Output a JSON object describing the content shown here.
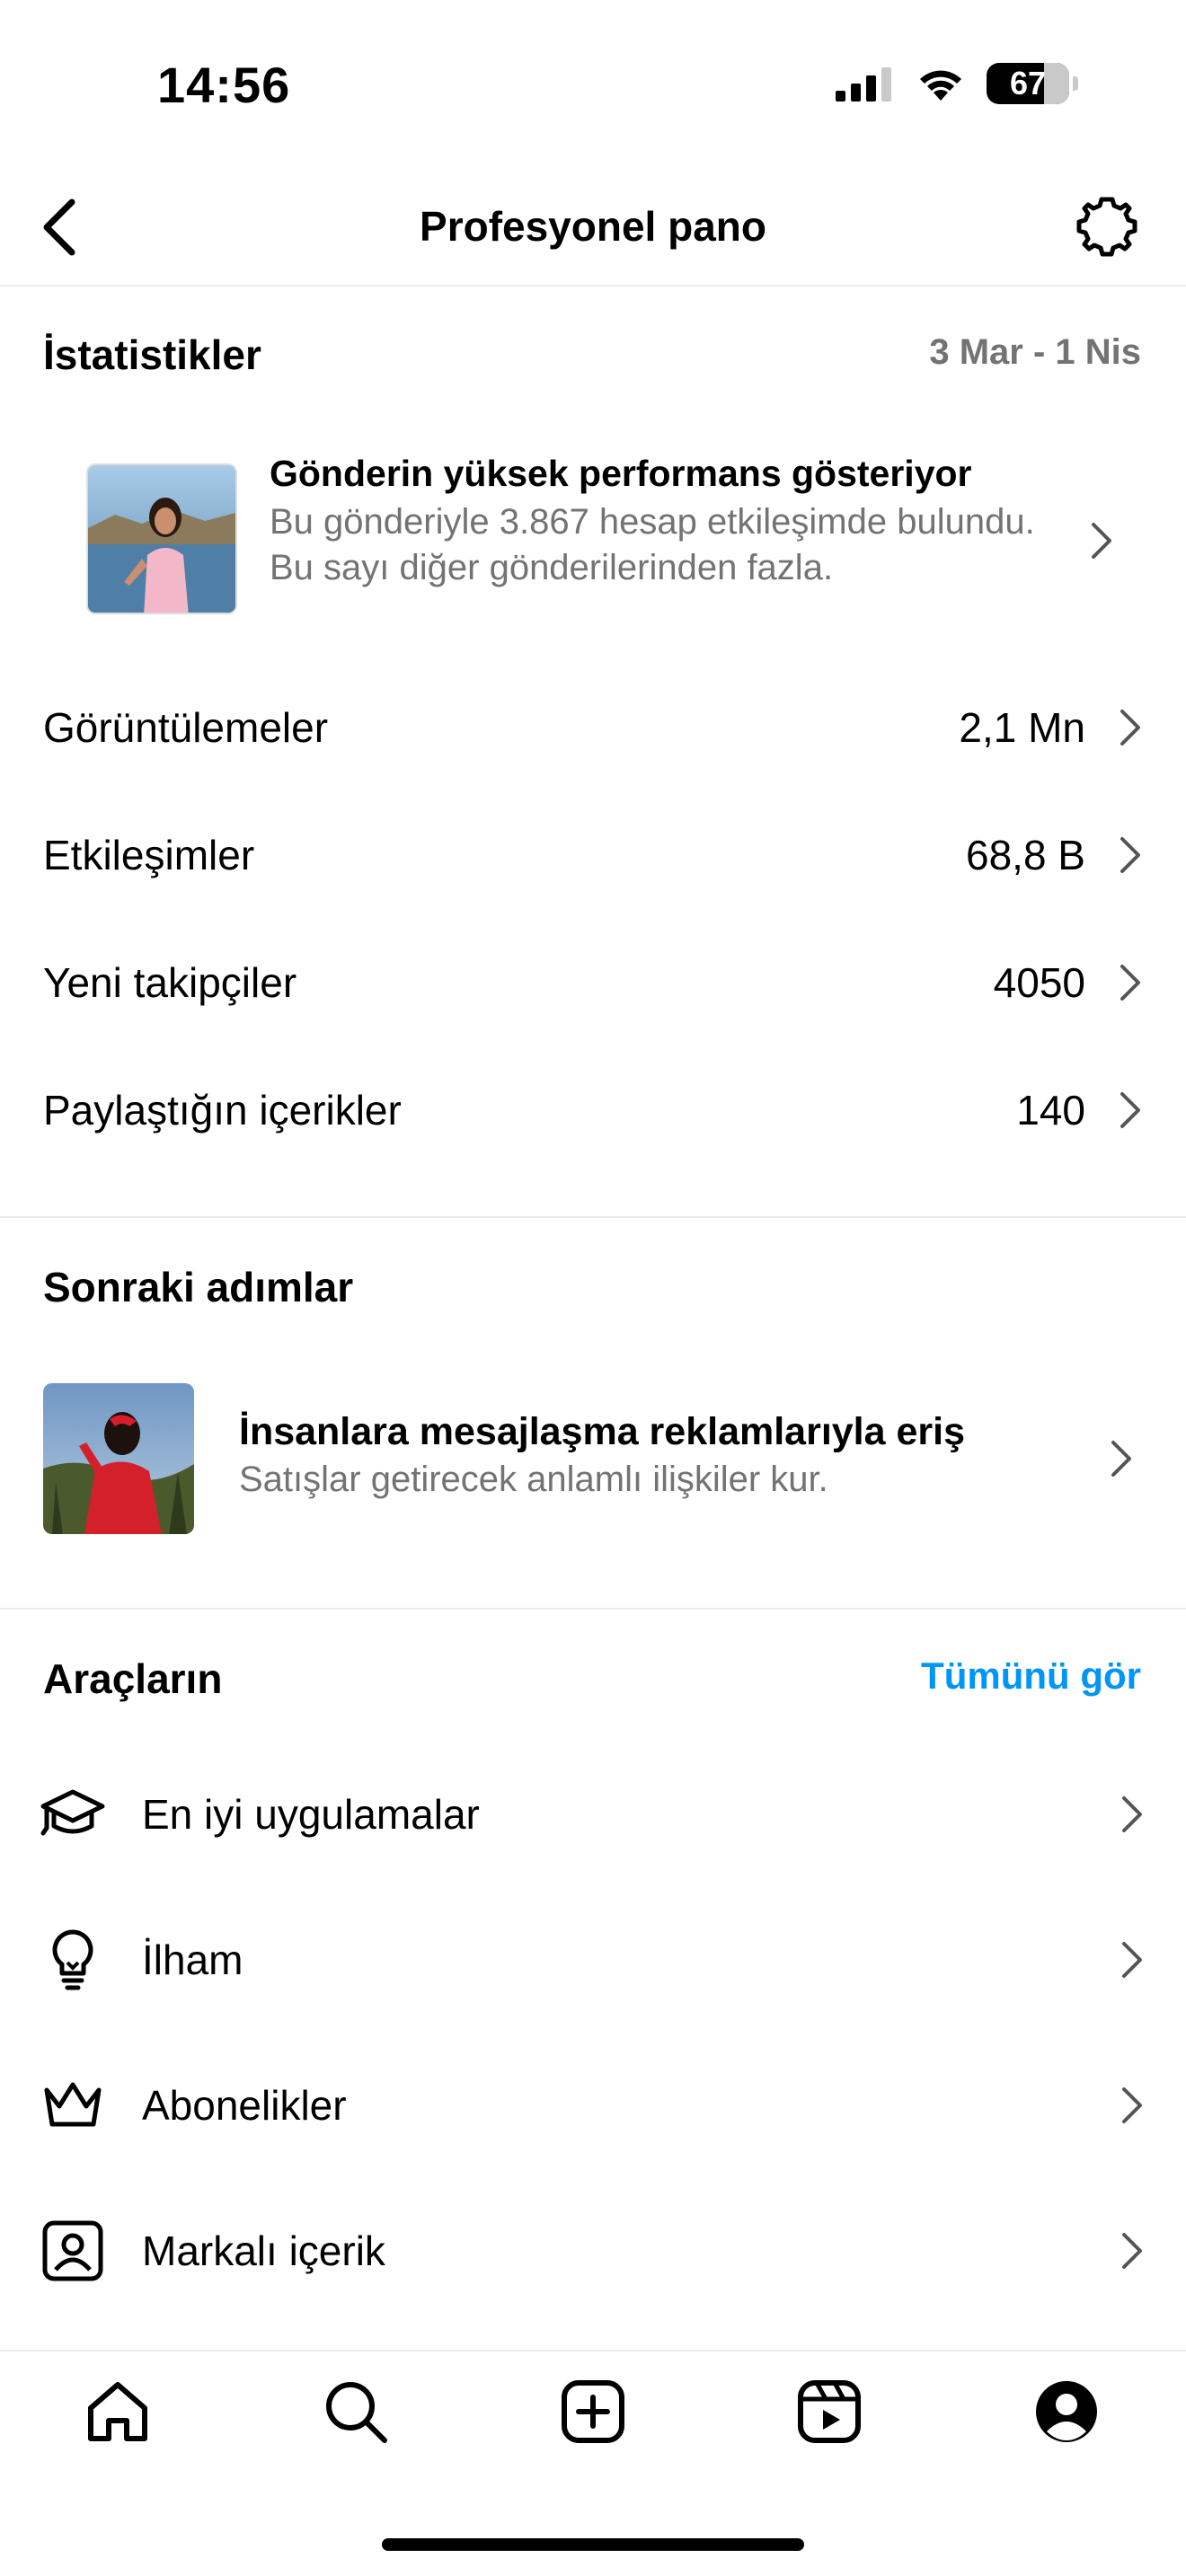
{
  "status_bar": {
    "time": "14:56",
    "battery_level": "67",
    "icons": [
      "signal-icon",
      "wifi-icon",
      "battery-icon"
    ]
  },
  "header": {
    "title": "Profesyonel pano",
    "icons": [
      "back-chevron-icon",
      "gear-icon"
    ]
  },
  "statistics": {
    "title": "İstatistikler",
    "date_range": "3 Mar - 1 Nis",
    "highlight": {
      "title": "Gönderin yüksek performans gösteriyor",
      "description": "Bu gönderiyle 3.867 hesap etkileşimde bulundu. Bu sayı diğer gönderilerinden fazla."
    },
    "rows": [
      {
        "label": "Görüntülemeler",
        "value": "2,1 Mn"
      },
      {
        "label": "Etkileşimler",
        "value": "68,8 B"
      },
      {
        "label": "Yeni takipçiler",
        "value": "4050"
      },
      {
        "label": "Paylaştığın içerikler",
        "value": "140"
      }
    ]
  },
  "next_steps": {
    "title": "Sonraki adımlar",
    "item": {
      "title": "İnsanlara mesajlaşma reklamlarıyla eriş",
      "description": "Satışlar getirecek anlamlı ilişkiler kur."
    }
  },
  "tools": {
    "title": "Araçların",
    "see_all": "Tümünü gör",
    "items": [
      {
        "label": "En iyi uygulamalar",
        "icon": "graduation-cap-icon"
      },
      {
        "label": "İlham",
        "icon": "lightbulb-icon"
      },
      {
        "label": "Abonelikler",
        "icon": "crown-icon"
      },
      {
        "label": "Markalı içerik",
        "icon": "branded-content-icon"
      }
    ]
  },
  "bottom_nav": {
    "items": [
      "home-icon",
      "search-icon",
      "create-icon",
      "reels-icon",
      "profile-icon"
    ]
  },
  "colors": {
    "accent": "#0095f6",
    "secondary_text": "#737373",
    "divider": "#ececec"
  }
}
